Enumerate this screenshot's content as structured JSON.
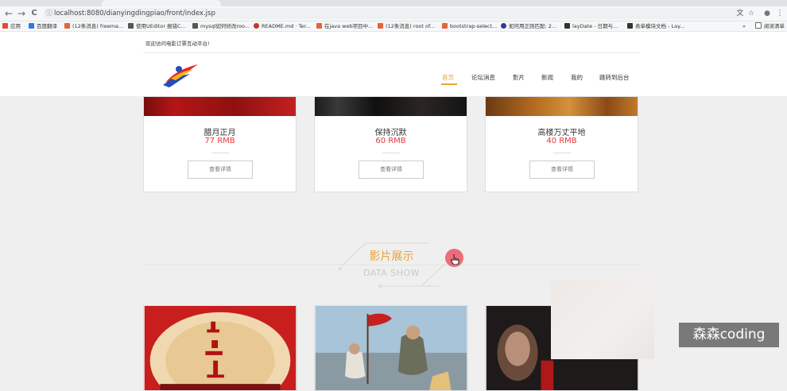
{
  "browser": {
    "address": "localhost:8080/dianyingdingpiao/front/index.jsp",
    "info_glyph": "ⓘ",
    "back_glyph": "←",
    "forward_glyph": "→",
    "reload_glyph": "C",
    "translate_glyph": "文",
    "star_glyph": "☆",
    "profile_glyph": "●",
    "menu_glyph": "⋮"
  },
  "bookmarks": {
    "items": [
      {
        "label": "应用",
        "color": "#e34a2d"
      },
      {
        "label": "百度翻译",
        "color": "#2c7be5"
      },
      {
        "label": "(12条消息) freema...",
        "color": "#e8623a"
      },
      {
        "label": "使用UEditor 报错C...",
        "color": "#555555"
      },
      {
        "label": "mysql如何修改roo...",
        "color": "#555555"
      },
      {
        "label": "README.md · Ter...",
        "color": "#c0392b"
      },
      {
        "label": "在java web项目中...",
        "color": "#e8623a"
      },
      {
        "label": "(12条消息) root of...",
        "color": "#e8623a"
      },
      {
        "label": "bootstrap-select...",
        "color": "#e8623a"
      },
      {
        "label": "如何用正则匹配: 2...",
        "color": "#2c3e91"
      },
      {
        "label": "layDate - 日期与...",
        "color": "#333333"
      },
      {
        "label": "表单模块文档 - Lay...",
        "color": "#333333"
      }
    ],
    "more": "»",
    "reading_list": "阅读清单"
  },
  "header": {
    "welcome": "欢迎访问电影订票互动平台!",
    "nav": [
      "首页",
      "论坛消息",
      "影片",
      "新闻",
      "我的",
      "跳转到后台"
    ]
  },
  "cards": [
    {
      "title": "腊月正月",
      "price": "77 RMB",
      "button": "查看详情"
    },
    {
      "title": "保持沉默",
      "price": "60 RMB",
      "button": "查看详情"
    },
    {
      "title": "高楼万丈平地",
      "price": "40 RMB",
      "button": "查看详情"
    }
  ],
  "section": {
    "title": "影片展示",
    "subtitle": "DATA SHOW"
  },
  "watermark": "森森coding",
  "colors": {
    "accent": "#e8a53a",
    "price": "#e03a3a",
    "cursor_highlight": "#ec6d7a"
  }
}
